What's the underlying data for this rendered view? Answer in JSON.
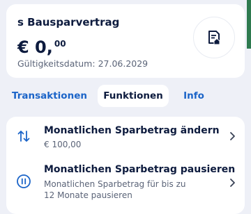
{
  "product": {
    "title": "s Bausparvertrag",
    "balance_main": "€ 0,",
    "balance_cents": "00",
    "validity_label": "Gültigkeitsdatum:",
    "validity_value": "27.06.2029",
    "document_icon": "document-home-icon"
  },
  "tabs": [
    {
      "label": "Transaktionen",
      "selected": false
    },
    {
      "label": "Funktionen",
      "selected": true
    },
    {
      "label": "Info",
      "selected": false
    }
  ],
  "functions": [
    {
      "title": "Monatlichen Sparbetrag ändern",
      "subtitle": "€ 100,00",
      "icon": "swap-arrows-icon"
    },
    {
      "title": "Monatlichen Sparbetrag pausieren",
      "subtitle": "Monatlichen Sparbetrag für bis zu 12 Monate pausieren",
      "icon": "pause-circle-icon"
    }
  ],
  "colors": {
    "accent": "#1b64c8",
    "text_primary": "#0d1b3e",
    "text_secondary": "#5b6478",
    "background": "#eef0f7",
    "brand_green": "#2e7a4f"
  }
}
